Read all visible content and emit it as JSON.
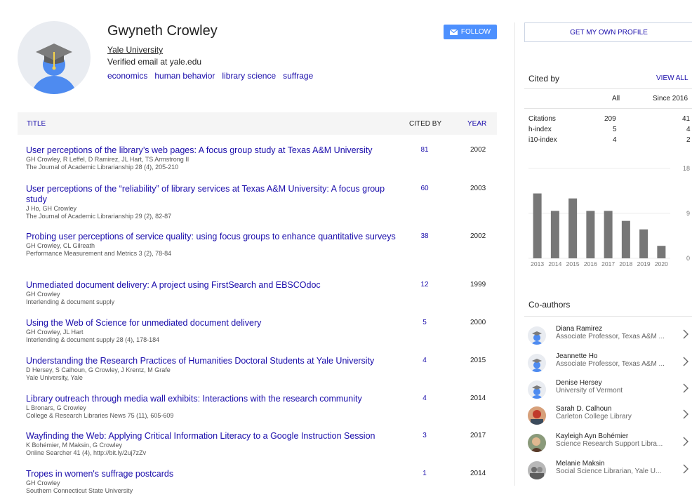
{
  "profile": {
    "name": "Gwyneth Crowley",
    "affiliation": "Yale University",
    "verified": "Verified email at yale.edu",
    "interests": [
      "economics",
      "human behavior",
      "library science",
      "suffrage"
    ],
    "follow_label": "FOLLOW"
  },
  "table": {
    "col_title": "TITLE",
    "col_cited": "CITED BY",
    "col_year": "YEAR"
  },
  "articles": [
    {
      "title": "User perceptions of the library’s web pages: A focus group study at Texas A&M University",
      "authors": "GH Crowley, R Leffel, D Ramirez, JL Hart, TS Armstrong II",
      "pub": "The Journal of Academic Librarianship 28 (4), 205-210",
      "cited": "81",
      "year": "2002"
    },
    {
      "title": "User perceptions of the “reliability” of library services at Texas A&M University: A focus group study",
      "authors": "J Ho, GH Crowley",
      "pub": "The Journal of Academic Librarianship 29 (2), 82-87",
      "cited": "60",
      "year": "2003"
    },
    {
      "title": "Probing user perceptions of service quality: using focus groups to enhance quantitative surveys",
      "authors": "GH Crowley, CL Gilreath",
      "pub": "Performance Measurement and Metrics 3 (2), 78-84",
      "cited": "38",
      "year": "2002"
    },
    {
      "title": "Unmediated document delivery: A project using FirstSearch and EBSCOdoc",
      "authors": "GH Crowley",
      "pub": "Interlending & document supply",
      "cited": "12",
      "year": "1999"
    },
    {
      "title": "Using the Web of Science for unmediated document delivery",
      "authors": "GH Crowley, JL Hart",
      "pub": "Interlending & document supply 28 (4), 178-184",
      "cited": "5",
      "year": "2000"
    },
    {
      "title": "Understanding the Research Practices of Humanities Doctoral Students at Yale University",
      "authors": "D Hersey, S Calhoun, G Crowley, J Krentz, M Grafe",
      "pub": "Yale University, Yale",
      "cited": "4",
      "year": "2015"
    },
    {
      "title": "Library outreach through media wall exhibits: Interactions with the research community",
      "authors": "L Bronars, G Crowley",
      "pub": "College & Research Libraries News 75 (11), 605-609",
      "cited": "4",
      "year": "2014"
    },
    {
      "title": "Wayfinding the Web: Applying Critical Information Literacy to a Google Instruction Session",
      "authors": "K Bohémier, M Maksin, G Crowley",
      "pub": "Online Searcher 41 (4), http://bit.ly/2uj7zZv",
      "cited": "3",
      "year": "2017"
    },
    {
      "title": "Tropes in women's suffrage postcards",
      "authors": "GH Crowley",
      "pub": "Southern Connecticut State University",
      "cited": "1",
      "year": "2014"
    }
  ],
  "sidebar": {
    "own_profile": "GET MY OWN PROFILE",
    "cited_by": "Cited by",
    "view_all": "VIEW ALL",
    "col_all": "All",
    "col_since": "Since 2016",
    "stats": [
      {
        "label": "Citations",
        "all": "209",
        "since": "41"
      },
      {
        "label": "h-index",
        "all": "5",
        "since": "4"
      },
      {
        "label": "i10-index",
        "all": "4",
        "since": "2"
      }
    ],
    "coauthors_title": "Co-authors",
    "coauthors": [
      {
        "name": "Diana Ramirez",
        "affil": "Associate Professor, Texas A&M ..."
      },
      {
        "name": "Jeannette Ho",
        "affil": "Associate Professor, Texas A&M ..."
      },
      {
        "name": "Denise Hersey",
        "affil": "University of Vermont"
      },
      {
        "name": "Sarah D. Calhoun",
        "affil": "Carleton College Library"
      },
      {
        "name": "Kayleigh Ayn Bohémier",
        "affil": "Science Research Support Libra..."
      },
      {
        "name": "Melanie Maksin",
        "affil": "Social Science Librarian, Yale U..."
      }
    ]
  },
  "chart_data": {
    "type": "bar",
    "categories": [
      "2013",
      "2014",
      "2015",
      "2016",
      "2017",
      "2018",
      "2019",
      "2020"
    ],
    "values": [
      13,
      9.5,
      12,
      9.5,
      9.5,
      7.5,
      5.8,
      2.5
    ],
    "yticks": [
      "18",
      "9",
      "0"
    ],
    "ylim": [
      0,
      18
    ],
    "color": "#777777"
  }
}
